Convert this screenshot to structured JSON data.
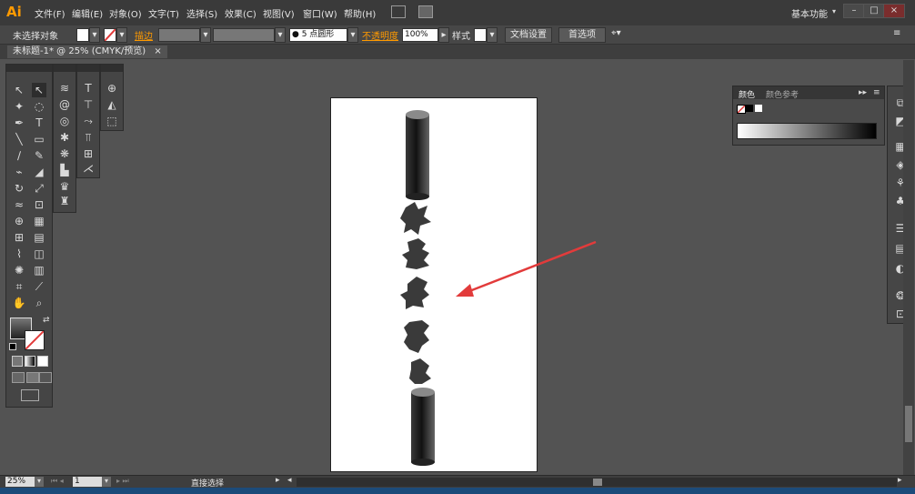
{
  "app": {
    "logo": "Ai",
    "workspace": "基本功能"
  },
  "menu": [
    "文件(F)",
    "编辑(E)",
    "对象(O)",
    "文字(T)",
    "选择(S)",
    "效果(C)",
    "视图(V)",
    "窗口(W)",
    "帮助(H)"
  ],
  "window_controls": [
    "–",
    "□",
    "×"
  ],
  "control_bar": {
    "selection": "未选择对象",
    "stroke_label": "描边",
    "brush": "5 点圆形",
    "opacity_label": "不透明度",
    "opacity_value": "100%",
    "style_label": "样式",
    "doc_setup": "文档设置",
    "preferences": "首选项"
  },
  "document": {
    "tab": "未标题-1* @ 25% (CMYK/预览)"
  },
  "color_panel": {
    "tab_color": "颜色",
    "tab_guide": "颜色参考"
  },
  "status": {
    "zoom": "25%",
    "page": "1",
    "tool": "直接选择"
  },
  "colors": {
    "accent": "#ff9a00",
    "arrow": "#e23b3b"
  }
}
